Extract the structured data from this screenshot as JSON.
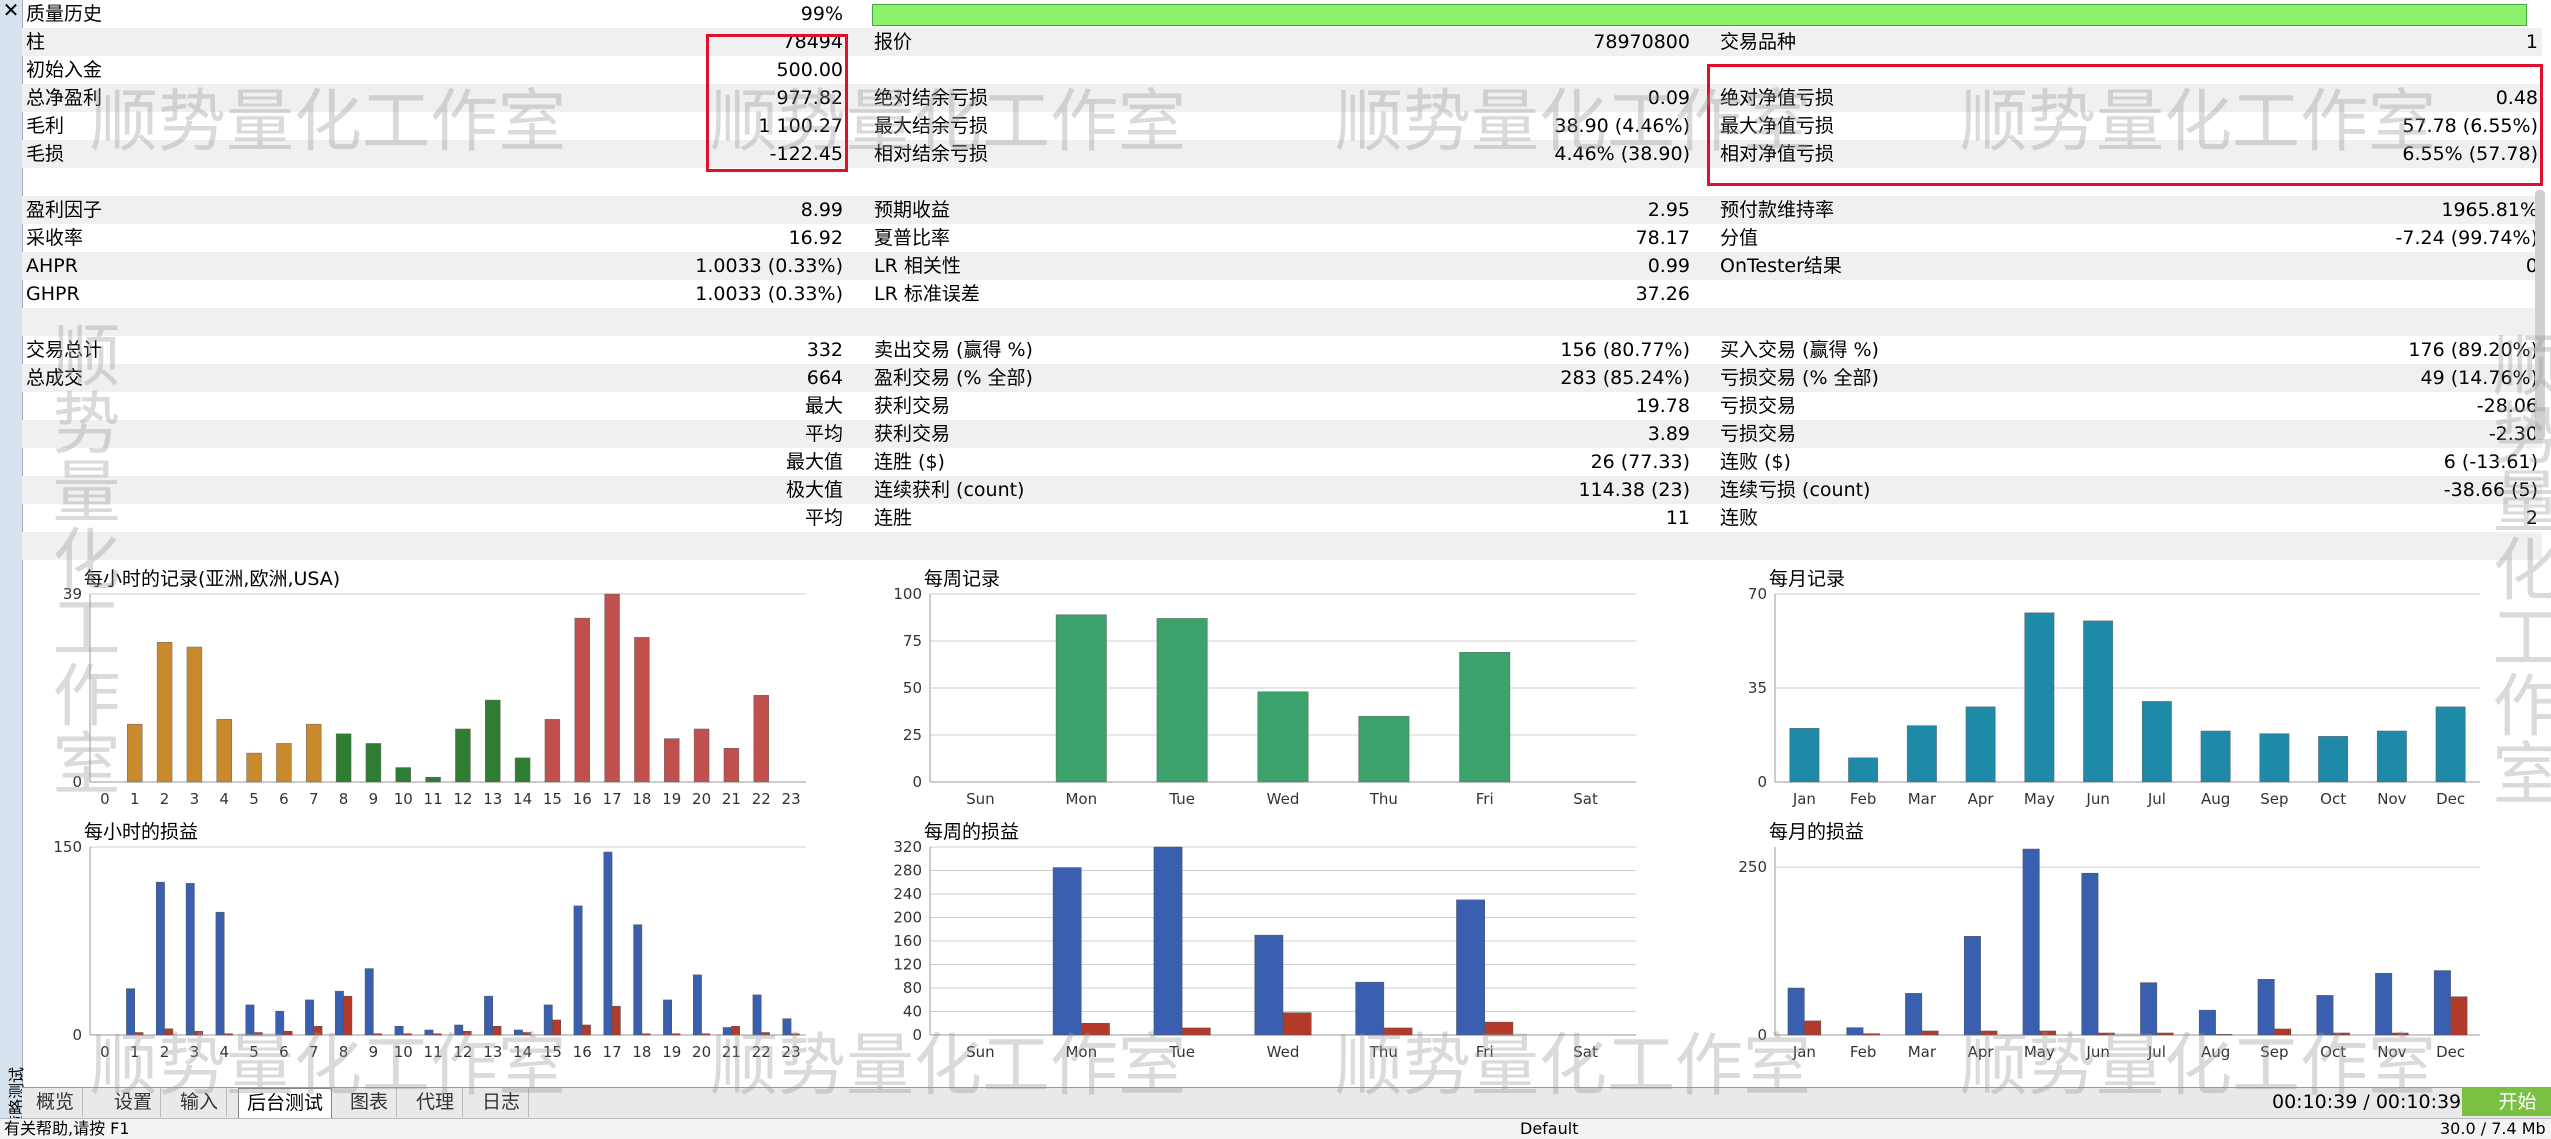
{
  "side_label": "策略测试",
  "stats_rows": [
    {
      "c1l": "质量历史",
      "c1v": "99%",
      "c2l": "",
      "c2v": "",
      "c3l": "",
      "c3v": "",
      "quality_fraction": 0.99
    },
    {
      "c1l": "柱",
      "c1v": "78494",
      "c2l": "报价",
      "c2v": "78970800",
      "c3l": "交易品种",
      "c3v": "1"
    },
    {
      "c1l": "初始入金",
      "c1v": "500.00",
      "c2l": "",
      "c2v": "",
      "c3l": "",
      "c3v": ""
    },
    {
      "c1l": "总净盈利",
      "c1v": "977.82",
      "c2l": "绝对结余亏损",
      "c2v": "0.09",
      "c3l": "绝对净值亏损",
      "c3v": "0.48"
    },
    {
      "c1l": "毛利",
      "c1v": "1 100.27",
      "c2l": "最大结余亏损",
      "c2v": "38.90 (4.46%)",
      "c3l": "最大净值亏损",
      "c3v": "57.78 (6.55%)"
    },
    {
      "c1l": "毛损",
      "c1v": "-122.45",
      "c2l": "相对结余亏损",
      "c2v": "4.46% (38.90)",
      "c3l": "相对净值亏损",
      "c3v": "6.55% (57.78)"
    },
    {
      "c1l": "",
      "c1v": "",
      "c2l": "",
      "c2v": "",
      "c3l": "",
      "c3v": ""
    },
    {
      "c1l": "盈利因子",
      "c1v": "8.99",
      "c2l": "预期收益",
      "c2v": "2.95",
      "c3l": "预付款维持率",
      "c3v": "1965.81%"
    },
    {
      "c1l": "采收率",
      "c1v": "16.92",
      "c2l": "夏普比率",
      "c2v": "78.17",
      "c3l": "分值",
      "c3v": "-7.24 (99.74%)"
    },
    {
      "c1l": "AHPR",
      "c1v": "1.0033 (0.33%)",
      "c2l": "LR 相关性",
      "c2v": "0.99",
      "c3l": "OnTester结果",
      "c3v": "0"
    },
    {
      "c1l": "GHPR",
      "c1v": "1.0033 (0.33%)",
      "c2l": "LR 标准误差",
      "c2v": "37.26",
      "c3l": "",
      "c3v": ""
    },
    {
      "c1l": "",
      "c1v": "",
      "c2l": "",
      "c2v": "",
      "c3l": "",
      "c3v": ""
    },
    {
      "c1l": "交易总计",
      "c1v": "332",
      "c2l": "卖出交易 (赢得 %)",
      "c2v": "156 (80.77%)",
      "c3l": "买入交易 (赢得 %)",
      "c3v": "176 (89.20%)"
    },
    {
      "c1l": "总成交",
      "c1v": "664",
      "c2l": "盈利交易 (% 全部)",
      "c2v": "283 (85.24%)",
      "c3l": "亏损交易 (% 全部)",
      "c3v": "49 (14.76%)"
    },
    {
      "c1l": "",
      "c1v": "最大",
      "c2l": "获利交易",
      "c2v": "19.78",
      "c3l": "亏损交易",
      "c3v": "-28.06"
    },
    {
      "c1l": "",
      "c1v": "平均",
      "c2l": "获利交易",
      "c2v": "3.89",
      "c3l": "亏损交易",
      "c3v": "-2.30"
    },
    {
      "c1l": "",
      "c1v": "最大值",
      "c2l": "连胜 ($)",
      "c2v": "26 (77.33)",
      "c3l": "连败 ($)",
      "c3v": "6 (-13.61)"
    },
    {
      "c1l": "",
      "c1v": "极大值",
      "c2l": "连续获利 (count)",
      "c2v": "114.38 (23)",
      "c3l": "连续亏损 (count)",
      "c3v": "-38.66 (5)"
    },
    {
      "c1l": "",
      "c1v": "平均",
      "c2l": "连胜",
      "c2v": "11",
      "c3l": "连败",
      "c3v": "2"
    },
    {
      "c1l": "",
      "c1v": "",
      "c2l": "",
      "c2v": "",
      "c3l": "",
      "c3v": ""
    }
  ],
  "chart_data": [
    {
      "id": "hourly_records",
      "type": "bar",
      "title": "每小时的记录(亚洲,欧洲,USA)",
      "categories": [
        "0",
        "1",
        "2",
        "3",
        "4",
        "5",
        "6",
        "7",
        "8",
        "9",
        "10",
        "11",
        "12",
        "13",
        "14",
        "15",
        "16",
        "17",
        "18",
        "19",
        "20",
        "21",
        "22",
        "23"
      ],
      "values": [
        0,
        12,
        29,
        28,
        13,
        6,
        8,
        12,
        10,
        8,
        3,
        1,
        11,
        17,
        5,
        13,
        34,
        39,
        30,
        9,
        11,
        7,
        18,
        0
      ],
      "colors": [
        "#c98a2e",
        "#c98a2e",
        "#c98a2e",
        "#c98a2e",
        "#c98a2e",
        "#c98a2e",
        "#c98a2e",
        "#c98a2e",
        "#2e7d32",
        "#2e7d32",
        "#2e7d32",
        "#2e7d32",
        "#2e7d32",
        "#2e7d32",
        "#2e7d32",
        "#c0504d",
        "#c0504d",
        "#c0504d",
        "#c0504d",
        "#c0504d",
        "#c0504d",
        "#c0504d",
        "#c0504d",
        "#c0504d"
      ],
      "yticks": [
        0,
        39
      ],
      "ylim": [
        0,
        39
      ]
    },
    {
      "id": "weekly_records",
      "type": "bar",
      "title": "每周记录",
      "categories": [
        "Sun",
        "Mon",
        "Tue",
        "Wed",
        "Thu",
        "Fri",
        "Sat"
      ],
      "values": [
        0,
        89,
        87,
        48,
        35,
        69,
        0
      ],
      "colors": [
        "#3aa26a",
        "#3aa26a",
        "#3aa26a",
        "#3aa26a",
        "#3aa26a",
        "#3aa26a",
        "#3aa26a"
      ],
      "yticks": [
        0,
        25,
        50,
        75,
        100
      ],
      "ylim": [
        0,
        100
      ]
    },
    {
      "id": "monthly_records",
      "type": "bar",
      "title": "每月记录",
      "categories": [
        "Jan",
        "Feb",
        "Mar",
        "Apr",
        "May",
        "Jun",
        "Jul",
        "Aug",
        "Sep",
        "Oct",
        "Nov",
        "Dec"
      ],
      "values": [
        20,
        9,
        21,
        28,
        63,
        60,
        30,
        19,
        18,
        17,
        19,
        28
      ],
      "colors": [
        "#1f8aa8",
        "#1f8aa8",
        "#1f8aa8",
        "#1f8aa8",
        "#1f8aa8",
        "#1f8aa8",
        "#1f8aa8",
        "#1f8aa8",
        "#1f8aa8",
        "#1f8aa8",
        "#1f8aa8",
        "#1f8aa8"
      ],
      "yticks": [
        0,
        35,
        70
      ],
      "ylim": [
        0,
        70
      ]
    },
    {
      "id": "hourly_pnl",
      "type": "bar",
      "title": "每小时的损益",
      "categories": [
        "0",
        "1",
        "2",
        "3",
        "4",
        "5",
        "6",
        "7",
        "8",
        "9",
        "10",
        "11",
        "12",
        "13",
        "14",
        "15",
        "16",
        "17",
        "18",
        "19",
        "20",
        "21",
        "22",
        "23"
      ],
      "series": [
        {
          "values": [
            0,
            37,
            122,
            121,
            98,
            24,
            19,
            28,
            35,
            53,
            7,
            4,
            8,
            31,
            4,
            24,
            103,
            146,
            88,
            28,
            48,
            6,
            32,
            13
          ],
          "color": "#3a5fb0"
        },
        {
          "values": [
            0,
            2,
            5,
            3,
            1,
            2,
            3,
            7,
            31,
            1,
            1,
            1,
            3,
            7,
            2,
            12,
            8,
            23,
            1,
            1,
            1,
            7,
            2,
            1
          ],
          "color": "#b33a2a"
        }
      ],
      "yticks": [
        0,
        150
      ],
      "ylim": [
        0,
        150
      ]
    },
    {
      "id": "weekly_pnl",
      "type": "bar",
      "title": "每周的损益",
      "categories": [
        "Sun",
        "Mon",
        "Tue",
        "Wed",
        "Thu",
        "Fri",
        "Sat"
      ],
      "series": [
        {
          "values": [
            0,
            285,
            320,
            170,
            90,
            230,
            0
          ],
          "color": "#3a5fb0"
        },
        {
          "values": [
            0,
            20,
            12,
            38,
            12,
            22,
            0
          ],
          "color": "#b33a2a"
        }
      ],
      "yticks": [
        0,
        40,
        80,
        120,
        160,
        200,
        240,
        280,
        320
      ],
      "ylim": [
        0,
        320
      ]
    },
    {
      "id": "monthly_pnl",
      "type": "bar",
      "title": "每月的损益",
      "categories": [
        "Jan",
        "Feb",
        "Mar",
        "Apr",
        "May",
        "Jun",
        "Jul",
        "Aug",
        "Sep",
        "Oct",
        "Nov",
        "Dec"
      ],
      "series": [
        {
          "values": [
            70,
            11,
            62,
            147,
            277,
            241,
            78,
            37,
            83,
            59,
            92,
            96
          ],
          "color": "#3a5fb0"
        },
        {
          "values": [
            21,
            2,
            6,
            6,
            6,
            3,
            3,
            1,
            9,
            3,
            3,
            57
          ],
          "color": "#b33a2a"
        }
      ],
      "yticks": [
        0,
        250
      ],
      "ylim": [
        0,
        280
      ]
    }
  ],
  "tabs": [
    {
      "label": "概览",
      "active": false
    },
    {
      "label": "设置",
      "active": false
    },
    {
      "label": "输入",
      "active": false
    },
    {
      "label": "后台测试",
      "active": true
    },
    {
      "label": "图表",
      "active": false
    },
    {
      "label": "代理",
      "active": false
    },
    {
      "label": "日志",
      "active": false
    }
  ],
  "elapsed_time": "00:10:39 / 00:10:39",
  "start_label": "开始",
  "status_left": "有关帮助,请按 F1",
  "status_mid": "Default",
  "status_right": "30.0 / 7.4 Mb",
  "watermark": "顺势量化工作室"
}
